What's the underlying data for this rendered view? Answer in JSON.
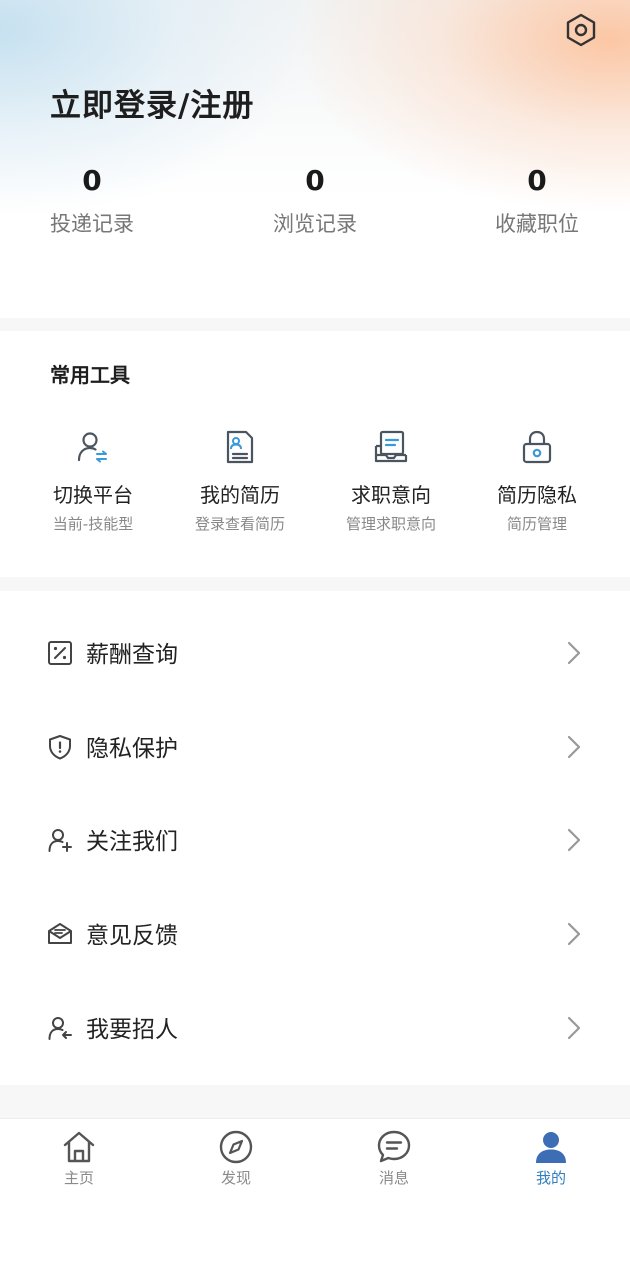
{
  "header": {
    "login_title": "立即登录/注册",
    "settings_icon": "hexagon-gear-icon"
  },
  "stats": [
    {
      "value": "0",
      "label": "投递记录"
    },
    {
      "value": "0",
      "label": "浏览记录"
    },
    {
      "value": "0",
      "label": "收藏职位"
    }
  ],
  "tools": {
    "title": "常用工具",
    "items": [
      {
        "name": "切换平台",
        "sub": "当前-技能型",
        "icon": "switch-user-icon"
      },
      {
        "name": "我的简历",
        "sub": "登录查看简历",
        "icon": "resume-icon"
      },
      {
        "name": "求职意向",
        "sub": "管理求职意向",
        "icon": "job-intent-icon"
      },
      {
        "name": "简历隐私",
        "sub": "简历管理",
        "icon": "lock-icon"
      }
    ]
  },
  "menu": [
    {
      "label": "薪酬查询",
      "icon": "salary-icon"
    },
    {
      "label": "隐私保护",
      "icon": "shield-icon"
    },
    {
      "label": "关注我们",
      "icon": "follow-user-icon"
    },
    {
      "label": "意见反馈",
      "icon": "feedback-mail-icon"
    },
    {
      "label": "我要招人",
      "icon": "recruit-user-icon"
    }
  ],
  "tabbar": [
    {
      "label": "主页",
      "icon": "home-icon"
    },
    {
      "label": "发现",
      "icon": "compass-icon"
    },
    {
      "label": "消息",
      "icon": "message-icon"
    },
    {
      "label": "我的",
      "icon": "profile-icon",
      "active": true
    }
  ],
  "colors": {
    "accent": "#2f7fc1",
    "icon_stroke": "#4a5560",
    "tool_accent": "#3a9ad9"
  }
}
